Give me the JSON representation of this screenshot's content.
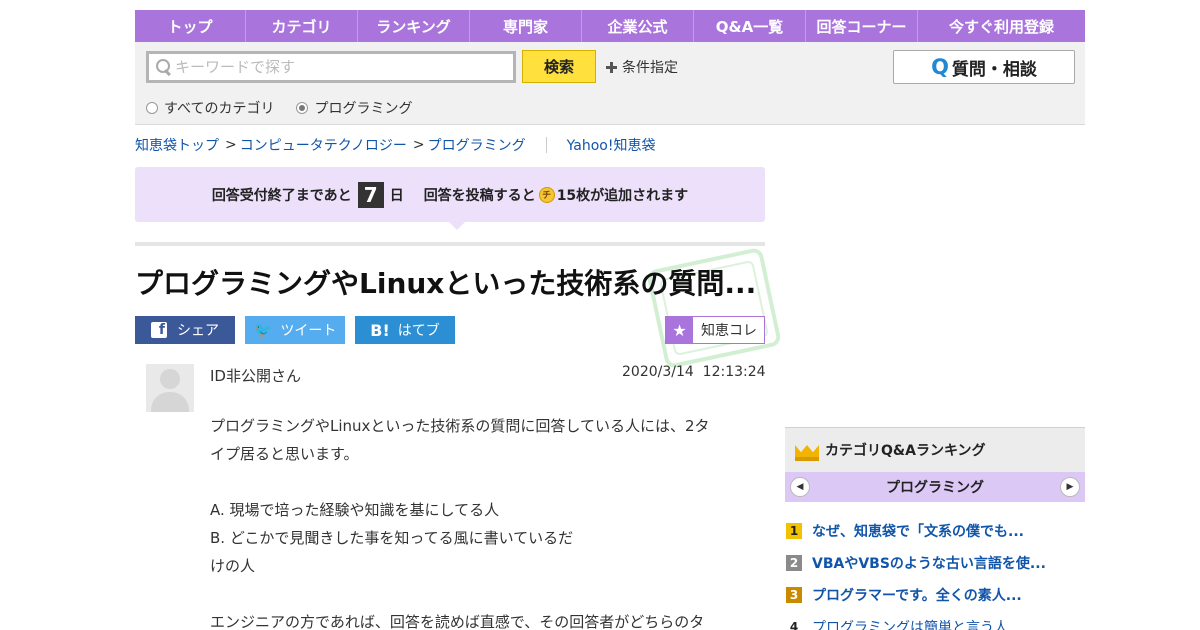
{
  "nav": {
    "items": [
      "トップ",
      "カテゴリ",
      "ランキング",
      "専門家",
      "企業公式",
      "Q&A一覧",
      "回答コーナー",
      "今すぐ利用登録"
    ]
  },
  "search": {
    "placeholder": "キーワードで探す",
    "button": "検索",
    "conditions": "条件指定",
    "ask_button": "質問・相談",
    "ask_icon": "Q",
    "scope_all": "すべてのカテゴリ",
    "scope_current": "プログラミング",
    "selected_scope": "プログラミング"
  },
  "breadcrumb": {
    "home": "知恵袋トップ",
    "sep": ">",
    "category": "コンピュータテクノロジー",
    "subcategory": "プログラミング",
    "site": "Yahoo!知恵袋"
  },
  "notice": {
    "prefix": "回答受付終了まであと",
    "days": "7",
    "day_unit": "日",
    "reward_prefix": "回答を投稿すると",
    "coin_glyph": "チ",
    "reward_suffix": "15枚が追加されます"
  },
  "question": {
    "title": "プログラミングやLinuxといった技術系の質問...",
    "author": "ID非公開さん",
    "date": "2020/3/14  12:13:24",
    "body": [
      "プログラミングやLinuxといった技術系の質問に回答している人には、2タ",
      "イプ居ると思います。",
      "",
      "A. 現場で培った経験や知識を基にしてる人",
      "B. どこかで見聞きした事を知ってる風に書いているだ",
      "けの人",
      "",
      "エンジニアの方であれば、回答を読めば直感で、その回答者がどちらのタ"
    ]
  },
  "share": {
    "facebook": "シェア",
    "facebook_icon": "f",
    "twitter": "ツイート",
    "twitter_icon": "🐦",
    "hatena": "はてブ",
    "hatena_icon": "B!",
    "collection": "知恵コレ",
    "collection_icon": "★"
  },
  "ranking": {
    "title": "カテゴリQ&Aランキング",
    "category": "プログラミング",
    "items": [
      {
        "rank": "1",
        "text": "なぜ、知恵袋で「文系の僕でも..."
      },
      {
        "rank": "2",
        "text": "VBAやVBSのような古い言語を使..."
      },
      {
        "rank": "3",
        "text": "プログラマーです。全くの素人..."
      },
      {
        "rank": "4",
        "text": "プログラミングは簡単と言う人..."
      }
    ]
  },
  "colors": {
    "nav": "#a974dc",
    "notice": "#ece0fb",
    "link": "#1155aa",
    "search_button": "#ffe03d",
    "facebook": "#3b5998",
    "twitter": "#55acee",
    "hatena": "#2c8fd4"
  }
}
